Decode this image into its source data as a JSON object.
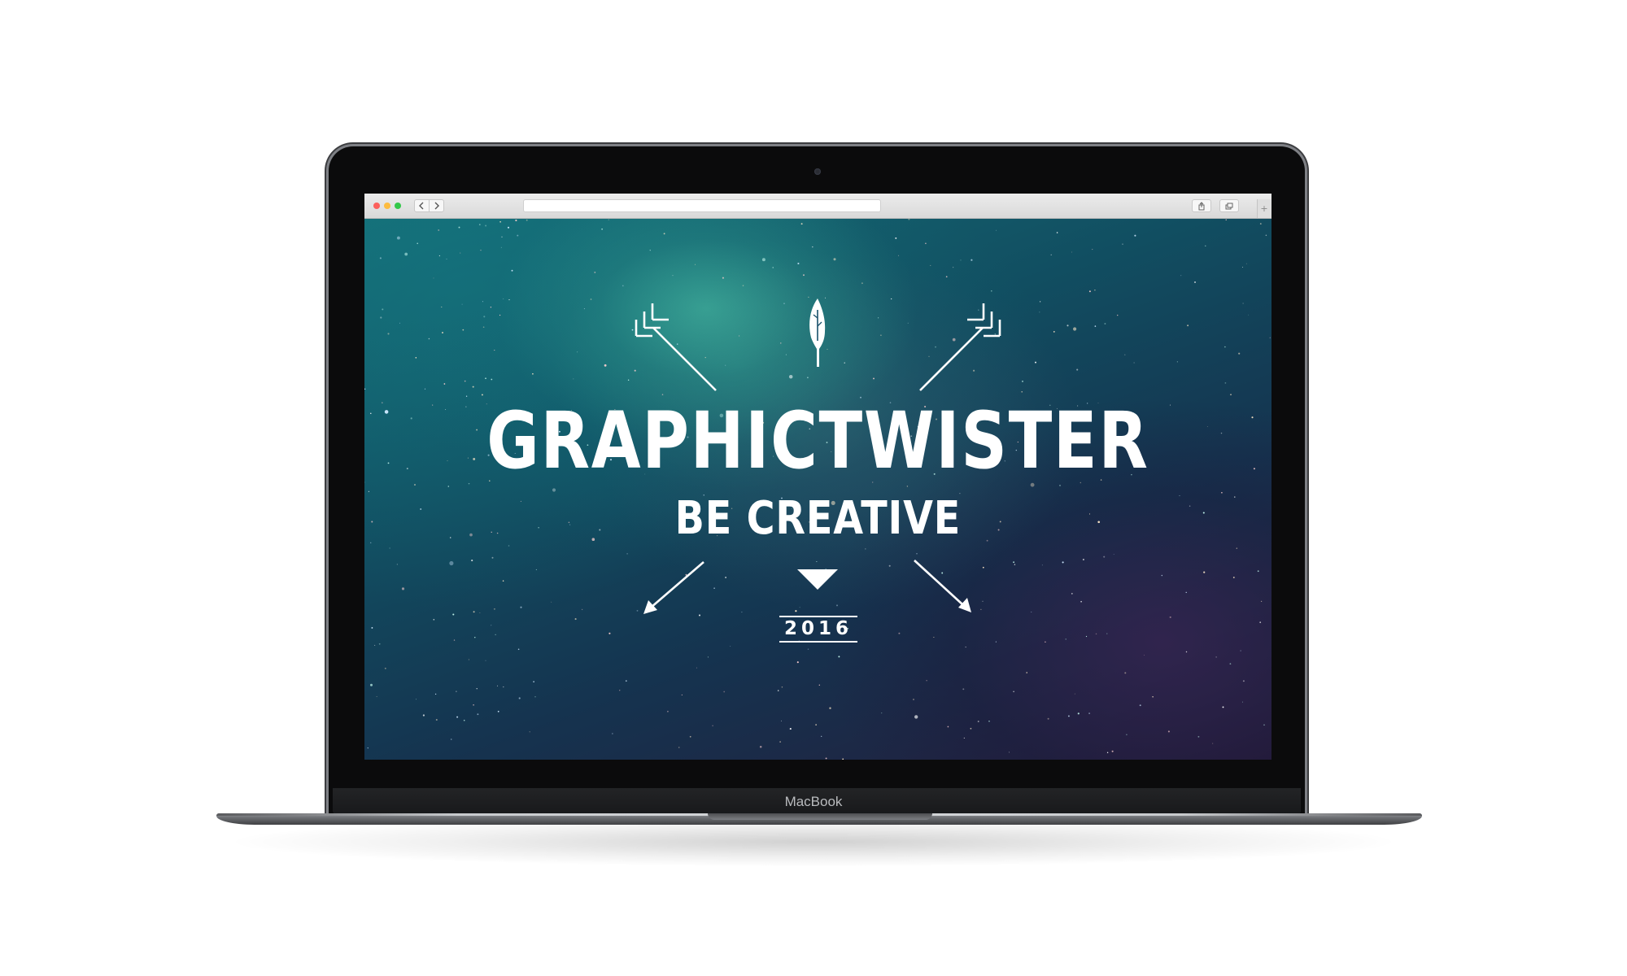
{
  "device": {
    "brand_label": "MacBook"
  },
  "browser": {
    "address_value": "",
    "back_icon": "chevron-left-icon",
    "forward_icon": "chevron-right-icon",
    "share_icon": "share-icon",
    "tabs_icon": "tabs-overview-icon",
    "new_tab_label": "+"
  },
  "page": {
    "title": "GRAPHICTWISTER",
    "subtitle": "BE CREATIVE",
    "year": "2016",
    "logo_icon": "feather-icon",
    "text_color": "#ffffff",
    "background_colors": [
      "#156d76",
      "#114e61",
      "#15334f",
      "#241d3c"
    ]
  }
}
